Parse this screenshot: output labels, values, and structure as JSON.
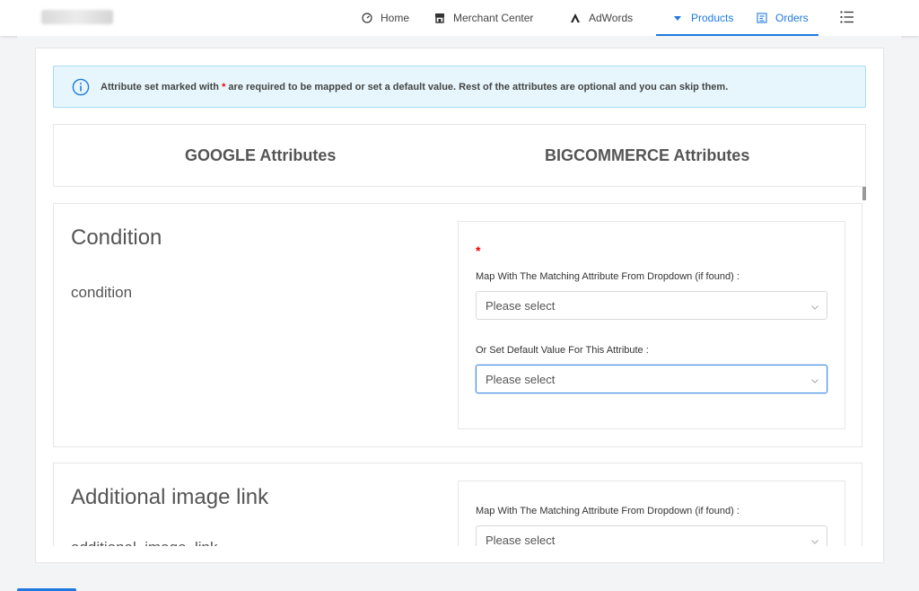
{
  "nav": {
    "home": "Home",
    "merchant_center": "Merchant Center",
    "adwords": "AdWords",
    "products": "Products",
    "orders": "Orders"
  },
  "notice": {
    "text_before": "Attribute set marked with ",
    "star": "*",
    "text_after": " are required to be mapped or set a default value. Rest of the attributes are optional and you can skip them."
  },
  "columns": {
    "google": "GOOGLE Attributes",
    "bigcommerce": "BIGCOMMERCE Attributes"
  },
  "attributes": [
    {
      "title": "Condition",
      "code": "condition",
      "required_star": "*",
      "map_label": "Map With The Matching Attribute From Dropdown (if found)",
      "map_value": "Please select",
      "default_label": "Or Set Default Value For This Attribute",
      "default_value": "Please select"
    },
    {
      "title": "Additional image link",
      "code": "additional_image_link",
      "map_label": "Map With The Matching Attribute From Dropdown (if found)",
      "map_value": "Please select"
    }
  ],
  "colors": {
    "accent": "#1f7ae0",
    "notice_bg": "#e6f6fc",
    "required": "#e00000"
  },
  "icons": {
    "home": "dashboard-gauge-icon",
    "merchant_center": "store-icon",
    "adwords": "adwords-icon",
    "products": "caret-down-icon",
    "orders": "orders-list-icon",
    "menu": "list-menu-icon",
    "notice": "info-icon",
    "select": "chevron-down-icon"
  }
}
